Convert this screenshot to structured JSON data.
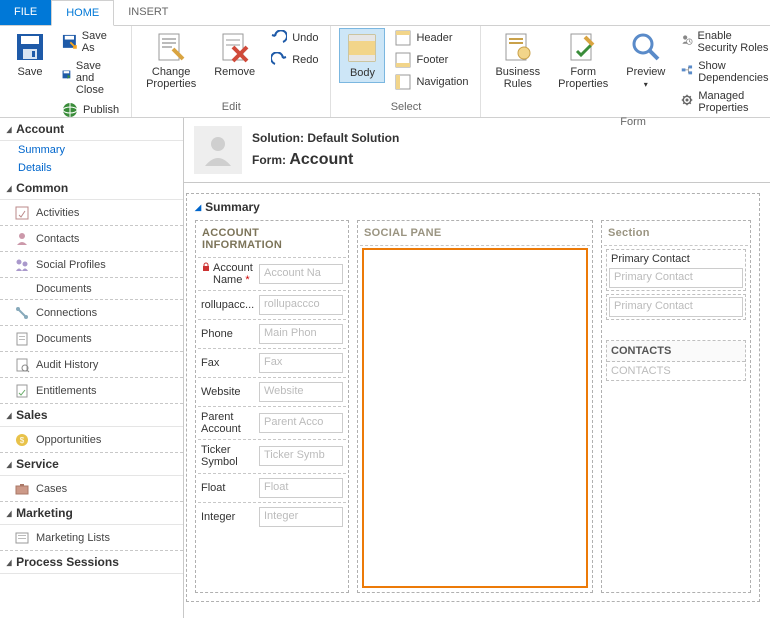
{
  "tabs": {
    "file": "FILE",
    "home": "HOME",
    "insert": "INSERT"
  },
  "ribbon": {
    "save": {
      "save": "Save",
      "saveas": "Save As",
      "saveclose": "Save and Close",
      "publish": "Publish",
      "group": "Save"
    },
    "edit": {
      "changeprops": "Change\nProperties",
      "remove": "Remove",
      "undo": "Undo",
      "redo": "Redo",
      "group": "Edit"
    },
    "select": {
      "body": "Body",
      "header": "Header",
      "footer": "Footer",
      "navigation": "Navigation",
      "group": "Select"
    },
    "form": {
      "businessrules": "Business\nRules",
      "formprops": "Form\nProperties",
      "preview": "Preview",
      "enablesec": "Enable Security Roles",
      "showdeps": "Show Dependencies",
      "managed": "Managed Properties",
      "group": "Form"
    }
  },
  "sidebar": {
    "account": {
      "title": "Account",
      "summary": "Summary",
      "details": "Details"
    },
    "common": {
      "title": "Common",
      "items": [
        "Activities",
        "Contacts",
        "Social Profiles",
        "Documents",
        "Connections",
        "Documents",
        "Audit History",
        "Entitlements"
      ]
    },
    "sales": {
      "title": "Sales",
      "items": [
        "Opportunities"
      ]
    },
    "service": {
      "title": "Service",
      "items": [
        "Cases"
      ]
    },
    "marketing": {
      "title": "Marketing",
      "items": [
        "Marketing Lists"
      ]
    },
    "process": {
      "title": "Process Sessions"
    }
  },
  "header": {
    "solution_prefix": "Solution: ",
    "solution": "Default Solution",
    "form_prefix": "Form: ",
    "form": "Account"
  },
  "summary": {
    "title": "Summary",
    "col1": {
      "header": "ACCOUNT INFORMATION",
      "fields": [
        {
          "label": "Account Name",
          "placeholder": "Account Na",
          "locked": true,
          "required": true
        },
        {
          "label": "rollupacc...",
          "placeholder": "rollupaccco"
        },
        {
          "label": "Phone",
          "placeholder": "Main Phon"
        },
        {
          "label": "Fax",
          "placeholder": "Fax"
        },
        {
          "label": "Website",
          "placeholder": "Website"
        },
        {
          "label": "Parent Account",
          "placeholder": "Parent Acco"
        },
        {
          "label": "Ticker Symbol",
          "placeholder": "Ticker Symb"
        },
        {
          "label": "Float",
          "placeholder": "Float"
        },
        {
          "label": "Integer",
          "placeholder": "Integer"
        }
      ]
    },
    "col2": {
      "header": "SOCIAL PANE"
    },
    "col3": {
      "header": "Section",
      "primary_label": "Primary Contact",
      "primary_placeholder": "Primary Contact",
      "primary2_placeholder": "Primary Contact",
      "contacts_header": "CONTACTS",
      "contacts_body": "CONTACTS"
    }
  }
}
